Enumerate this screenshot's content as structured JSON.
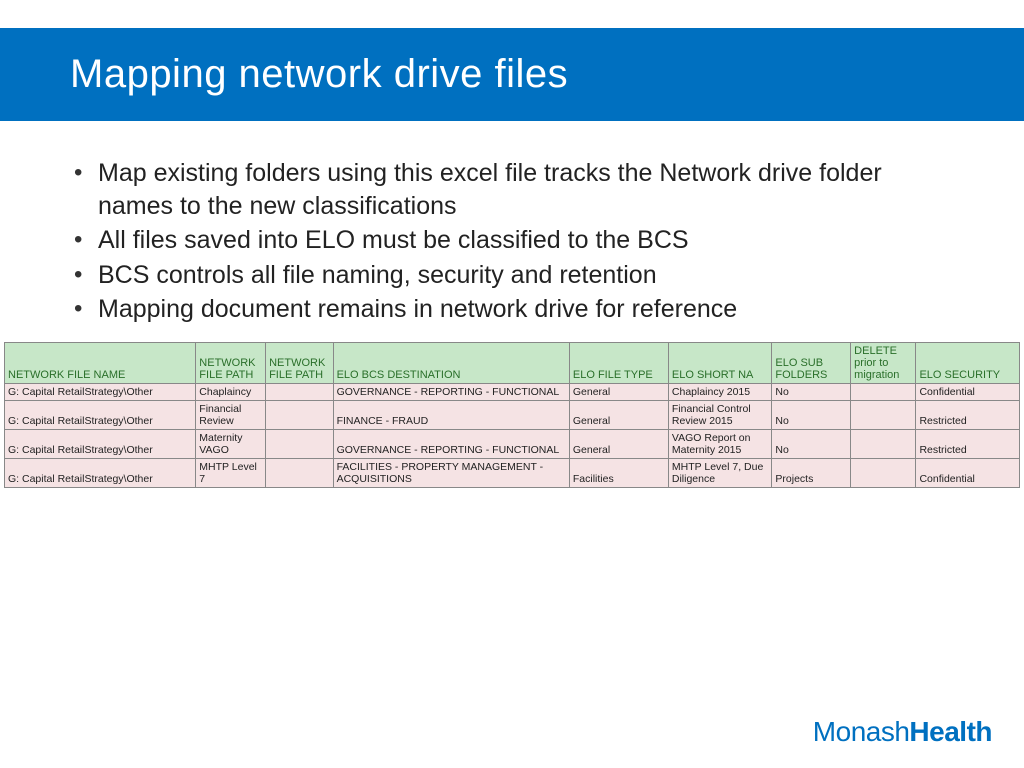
{
  "title": "Mapping network drive files",
  "bullets": [
    "Map existing folders using this excel file tracks the Network drive folder names to the new classifications",
    "All files saved into ELO must be classified to the BCS",
    "BCS controls all file naming, security and retention",
    "Mapping document remains in network drive for reference"
  ],
  "table": {
    "headers": [
      "NETWORK FILE NAME",
      "NETWORK FILE PATH",
      "NETWORK FILE PATH",
      "ELO BCS DESTINATION",
      "ELO FILE TYPE",
      "ELO SHORT NA",
      "ELO SUB FOLDERS",
      "DELETE prior to migration",
      "ELO SECURITY"
    ],
    "rows": [
      {
        "nfn": "G: Capital RetailStrategy\\Other",
        "nfp1": "Chaplaincy",
        "nfp2": "",
        "bcs": "GOVERNANCE - REPORTING - FUNCTIONAL",
        "ft": "General",
        "sn": "Chaplaincy 2015",
        "sub": "No",
        "del": "",
        "sec": "Confidential"
      },
      {
        "nfn": "G: Capital RetailStrategy\\Other",
        "nfp1": "Financial Review",
        "nfp2": "",
        "bcs": "FINANCE - FRAUD",
        "ft": "General",
        "sn": "Financial Control Review 2015",
        "sub": "No",
        "del": "",
        "sec": "Restricted"
      },
      {
        "nfn": "G: Capital RetailStrategy\\Other",
        "nfp1": "Maternity VAGO",
        "nfp2": "",
        "bcs": "GOVERNANCE - REPORTING - FUNCTIONAL",
        "ft": "General",
        "sn": "VAGO Report on Maternity 2015",
        "sub": "No",
        "del": "",
        "sec": "Restricted"
      },
      {
        "nfn": "G: Capital RetailStrategy\\Other",
        "nfp1": "MHTP Level 7",
        "nfp2": "",
        "bcs": "FACILITIES - PROPERTY MANAGEMENT - ACQUISITIONS",
        "ft": "Facilities",
        "sn": "MHTP Level 7, Due Diligence",
        "sub": "Projects",
        "del": "",
        "sec": "Confidential"
      }
    ]
  },
  "logo": {
    "part1": "Monash",
    "part2": "Health"
  }
}
